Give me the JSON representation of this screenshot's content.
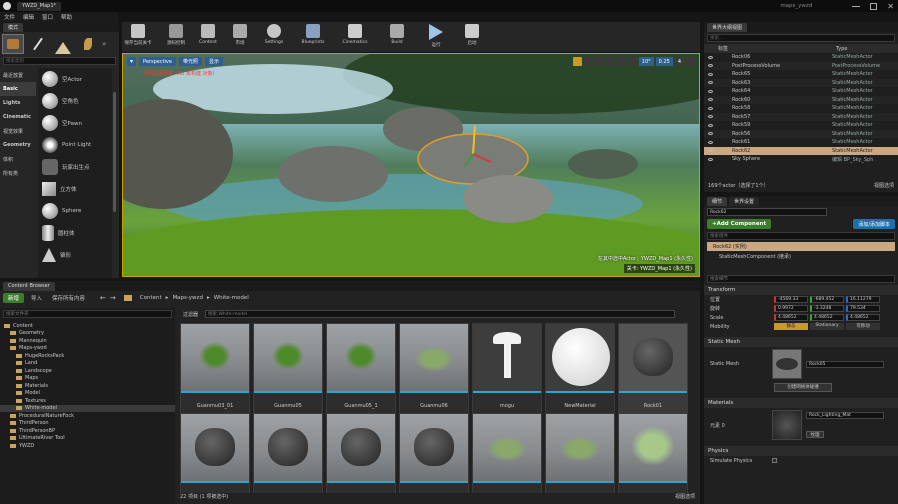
{
  "window": {
    "title": "YWZD_Map1*",
    "project": "maps_ywzd"
  },
  "menu": [
    "文件",
    "编辑",
    "窗口",
    "帮助"
  ],
  "modes": {
    "tab": "模式",
    "search_placeholder": "搜索类别",
    "categories": [
      "最近放置",
      "Basic",
      "Lights",
      "Cinematic",
      "视觉效果",
      "Geometry",
      "体积",
      "所有类"
    ],
    "items": [
      "空Actor",
      "空角色",
      "空Pawn",
      "Point Light",
      "玩家出生点",
      "立方体",
      "Sphere",
      "圆柱体",
      "锥形"
    ]
  },
  "toolbar": [
    {
      "label": "保存当前关卡",
      "icon": "save-icon"
    },
    {
      "label": "源码控制",
      "icon": "source-control-icon"
    },
    {
      "label": "Content",
      "icon": "content-icon"
    },
    {
      "label": "市场",
      "icon": "marketplace-icon"
    },
    {
      "label": "Settings",
      "icon": "settings-icon"
    },
    {
      "label": "Blueprints",
      "icon": "blueprints-icon"
    },
    {
      "label": "Cinematics",
      "icon": "cinematics-icon"
    },
    {
      "label": "Build",
      "icon": "build-icon"
    },
    {
      "label": "运行",
      "icon": "play-icon"
    },
    {
      "label": "启动",
      "icon": "launch-icon"
    }
  ],
  "viewport": {
    "perspective": "Perspective",
    "lit": "带光照",
    "show": "显示",
    "warning": "光照需要重建（30 未构建 对象）",
    "info_line": "在其中选中Actor：YWZD_Map1 (永久性)",
    "level": "关卡: YWZD_Map1 (永久性)",
    "snap_angle": "10°",
    "scale": "0.25",
    "speed": "4"
  },
  "outliner": {
    "tab": "世界大纲视图",
    "search_placeholder": "搜索...",
    "col_label": "标签",
    "col_type": "Type",
    "rows": [
      {
        "label": "Rock06",
        "type": "StaticMeshActor"
      },
      {
        "label": "PostProcessVolume",
        "type": "PostProcessVolume"
      },
      {
        "label": "Rock65",
        "type": "StaticMeshActor"
      },
      {
        "label": "Rock63",
        "type": "StaticMeshActor"
      },
      {
        "label": "Rock64",
        "type": "StaticMeshActor"
      },
      {
        "label": "Rock60",
        "type": "StaticMeshActor"
      },
      {
        "label": "Rock58",
        "type": "StaticMeshActor"
      },
      {
        "label": "Rock57",
        "type": "StaticMeshActor"
      },
      {
        "label": "Rock59",
        "type": "StaticMeshActor"
      },
      {
        "label": "Rock56",
        "type": "StaticMeshActor"
      },
      {
        "label": "Rock61",
        "type": "StaticMeshActor"
      },
      {
        "label": "Rock62",
        "type": "StaticMeshActor"
      },
      {
        "label": "Sky Sphere",
        "type": "编辑 BP_Sky_Sph"
      }
    ],
    "footer": "169个actor（选择了1个）",
    "view_options": "视图选项"
  },
  "details": {
    "tab1": "细节",
    "tab2": "世界设置",
    "actor_name": "Rock62",
    "add_component": "+Add Component",
    "blueprint_btn": "添加/添加脚本",
    "search_components": "搜索组件",
    "root_component": "Rock62 (实例)",
    "mesh_component": "StaticMeshComponent (继承)",
    "search_details": "搜索细节",
    "transform": "Transform",
    "location_label": "位置",
    "rotation_label": "旋转",
    "scale_label": "Scale",
    "mobility_label": "Mobility",
    "location": [
      "-4569.33",
      "-689.452",
      "16.11279"
    ],
    "rotation": [
      "0.9972",
      "-3.3248",
      "79.534"
    ],
    "scale": [
      "4.48652",
      "4.48652",
      "4.48652"
    ],
    "mobility": [
      "静态",
      "Stationary",
      "可移动"
    ],
    "static_mesh_section": "Static Mesh",
    "static_mesh_label": "Static Mesh",
    "static_mesh_value": "Rock05",
    "build_btn": "创建网格体碰撞",
    "materials_section": "Materials",
    "element_label": "元素 0",
    "material_value": "Rock_Lighting_Mat",
    "texture_btn": "纹理",
    "physics_section": "Physics",
    "simulate_label": "Simulate Physics"
  },
  "content_browser": {
    "tab": "Content Browser",
    "add_new": "新增",
    "import": "导入",
    "save_all": "保存所有内容",
    "breadcrumb": [
      "Content",
      "Maps-ywzd",
      "White-model"
    ],
    "search_folders": "搜索文件夹",
    "filters": "过滤器",
    "search_assets": "搜索 White-model",
    "tree": [
      {
        "label": "Content",
        "level": 0
      },
      {
        "label": "Geometry",
        "level": 1
      },
      {
        "label": "Mannequin",
        "level": 1
      },
      {
        "label": "Maps-ywzd",
        "level": 1
      },
      {
        "label": "HugeRocksPack",
        "level": 2
      },
      {
        "label": "Land",
        "level": 2
      },
      {
        "label": "Landscope",
        "level": 2
      },
      {
        "label": "Maps",
        "level": 2
      },
      {
        "label": "Materials",
        "level": 2
      },
      {
        "label": "Model",
        "level": 2
      },
      {
        "label": "Textures",
        "level": 2
      },
      {
        "label": "White-model",
        "level": 2
      },
      {
        "label": "ProceduralNatureFock",
        "level": 1
      },
      {
        "label": "ThirdPerson",
        "level": 1
      },
      {
        "label": "ThirdPersonBP",
        "level": 1
      },
      {
        "label": "UltimateRiver Tool",
        "level": 1
      },
      {
        "label": "YWZD",
        "level": 1
      }
    ],
    "assets_row1": [
      "Guanmu03_01",
      "Guanmu05",
      "Guanmu05_1",
      "Guanmu06",
      "mogu",
      "NewMaterial",
      "Rock01"
    ],
    "assets_row2": [
      "",
      "",
      "",
      "",
      "",
      "",
      ""
    ],
    "footer": "22 项目 (1 项被选中)",
    "view_options": "视图选项"
  },
  "colors": {
    "accent": "#2aa7d4",
    "selected": "#c9a882",
    "warning": "#ff3b30"
  }
}
